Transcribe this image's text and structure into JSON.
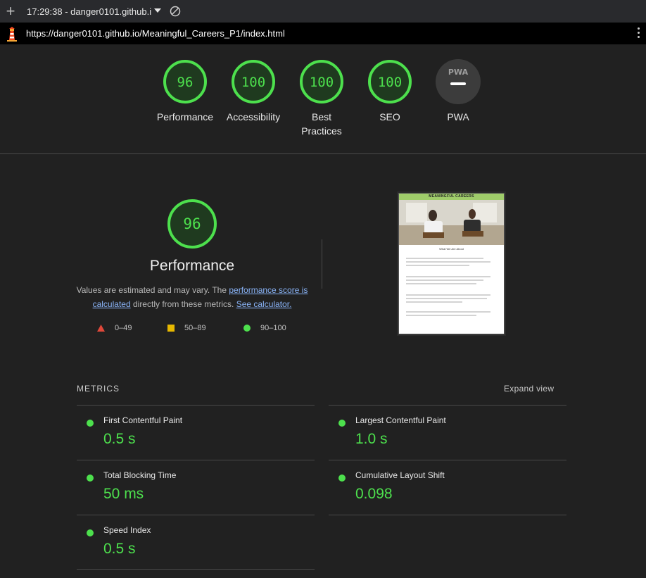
{
  "topbar": {
    "report_title": "17:29:38 - danger0101.github.i"
  },
  "urlbar": {
    "url": "https://danger0101.github.io/Meaningful_Careers_P1/index.html"
  },
  "scores": [
    {
      "label": "Performance",
      "value": "96"
    },
    {
      "label": "Accessibility",
      "value": "100"
    },
    {
      "label": "Best Practices",
      "value": "100"
    },
    {
      "label": "SEO",
      "value": "100"
    },
    {
      "label": "PWA",
      "value": "PWA"
    }
  ],
  "performance": {
    "score": "96",
    "title": "Performance",
    "desc_prefix": "Values are estimated and may vary. The ",
    "link_score": "performance score is calculated",
    "desc_middle": " directly from these metrics. ",
    "link_calc": "See calculator."
  },
  "legend": {
    "fail": "0–49",
    "average": "50–89",
    "pass": "90–100"
  },
  "screenshot": {
    "header_text": "MEANINGFUL CAREERS",
    "subheading": "What We Are About"
  },
  "metrics": {
    "heading": "METRICS",
    "expand_label": "Expand view",
    "items": [
      {
        "name": "First Contentful Paint",
        "value": "0.5 s"
      },
      {
        "name": "Largest Contentful Paint",
        "value": "1.0 s"
      },
      {
        "name": "Total Blocking Time",
        "value": "50 ms"
      },
      {
        "name": "Cumulative Layout Shift",
        "value": "0.098"
      },
      {
        "name": "Speed Index",
        "value": "0.5 s"
      }
    ]
  },
  "colors": {
    "pass": "#4de04d",
    "average": "#e6b800",
    "fail": "#e0483a",
    "link": "#8ab4f8"
  }
}
